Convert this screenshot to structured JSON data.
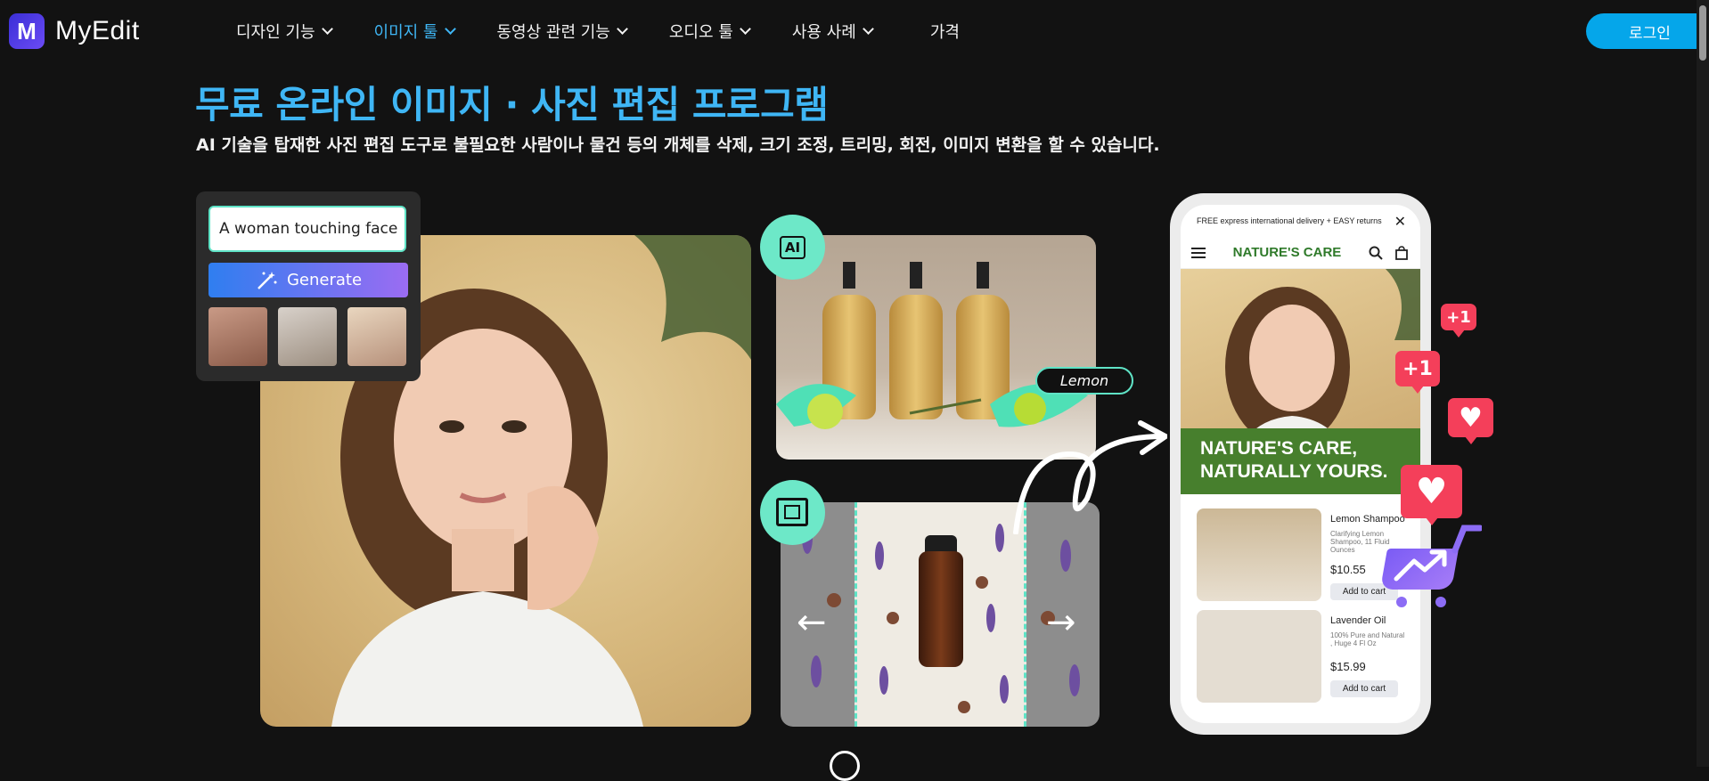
{
  "brand": {
    "logo_letter": "M",
    "name": "MyEdit"
  },
  "nav": {
    "items": [
      {
        "label": "디자인 기능"
      },
      {
        "label": "이미지 툴"
      },
      {
        "label": "동영상 관련 기능"
      },
      {
        "label": "오디오 툴"
      },
      {
        "label": "사용 사례"
      }
    ],
    "pricing": "가격",
    "login": "로그인",
    "active_color": "#3fb6f5"
  },
  "hero": {
    "title": "무료 온라인 이미지 · 사진 편집 프로그램",
    "subtitle": "AI 기술을 탑재한 사진 편집 도구로 불필요한 사람이나 물건 등의 개체를 삭제, 크기 조정, 트리밍, 회전, 이미지 변환을 할 수 있습니다."
  },
  "generator": {
    "prompt": "A woman touching face",
    "button": "Generate"
  },
  "badges": {
    "ai": "AI",
    "lemon_tag": "Lemon"
  },
  "phone": {
    "promo": "FREE express international delivery + EASY returns",
    "close": "✕",
    "brand": "NATURE'S CARE",
    "banner_line1": "NATURE'S CARE,",
    "banner_line2": "NATURALLY YOURS.",
    "products": [
      {
        "name": "Lemon Shampoo",
        "desc": "Clarifying Lemon Shampoo, 11 Fluid Ounces",
        "price": "$10.55",
        "cta": "Add to cart"
      },
      {
        "name": "Lavender Oil",
        "desc": "100% Pure and Natural , Huge 4 Fl Oz",
        "price": "$15.99",
        "cta": "Add to cart"
      }
    ]
  },
  "social": {
    "plus_one": "+1",
    "heart": "♥"
  },
  "arrows": {
    "left": "←",
    "right": "→"
  },
  "colors": {
    "accent": "#3fb6f5",
    "login_bg": "#05a6ea",
    "mint": "#6de8c8",
    "like": "#f43f5a",
    "green_banner": "#477f2d"
  }
}
